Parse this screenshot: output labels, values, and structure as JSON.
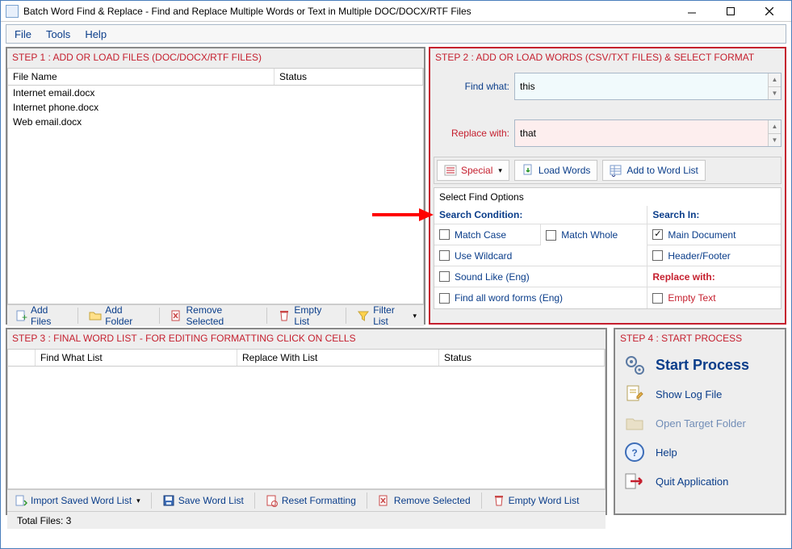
{
  "title": "Batch Word Find & Replace - Find and Replace Multiple Words or Text  in Multiple DOC/DOCX/RTF Files",
  "menu": {
    "file": "File",
    "tools": "Tools",
    "help": "Help"
  },
  "step1": {
    "title": "STEP 1 : ADD OR LOAD FILES (DOC/DOCX/RTF FILES)",
    "cols": {
      "file": "File Name",
      "status": "Status"
    },
    "files": [
      {
        "name": "Internet email.docx"
      },
      {
        "name": "Internet phone.docx"
      },
      {
        "name": "Web email.docx"
      }
    ],
    "buttons": {
      "add_files": "Add Files",
      "add_folder": "Add Folder",
      "remove_selected": "Remove Selected",
      "empty_list": "Empty List",
      "filter_list": "Filter List"
    }
  },
  "step2": {
    "title": "STEP 2 : ADD OR LOAD WORDS (CSV/TXT FILES) & SELECT FORMAT",
    "find_label": "Find what:",
    "find_value": "this",
    "replace_label": "Replace with:",
    "replace_value": "that",
    "buttons": {
      "special": "Special",
      "load_words": "Load Words",
      "add_to_list": "Add to Word List"
    },
    "options_title": "Select Find Options",
    "search_condition_head": "Search Condition:",
    "search_in_head": "Search In:",
    "replace_with_head": "Replace with:",
    "cond": {
      "match_case": "Match Case",
      "match_whole": "Match Whole",
      "use_wildcard": "Use Wildcard",
      "sound_like": "Sound Like (Eng)",
      "find_all_forms": "Find all word forms (Eng)"
    },
    "searchin": {
      "main_doc": "Main Document",
      "header_footer": "Header/Footer"
    },
    "replace": {
      "empty_text": "Empty Text"
    }
  },
  "step3": {
    "title": "STEP 3 : FINAL WORD LIST - FOR EDITING FORMATTING CLICK ON CELLS",
    "cols": {
      "find": "Find What List",
      "replace": "Replace With List",
      "status": "Status"
    },
    "buttons": {
      "import": "Import Saved Word List",
      "save": "Save Word List",
      "reset": "Reset Formatting",
      "remove": "Remove Selected",
      "empty": "Empty Word List"
    },
    "footer": "Total Files: 3"
  },
  "step4": {
    "title": "STEP 4 : START PROCESS",
    "start": "Start Process",
    "log": "Show Log File",
    "open_folder": "Open Target Folder",
    "help": "Help",
    "quit": "Quit Application"
  }
}
